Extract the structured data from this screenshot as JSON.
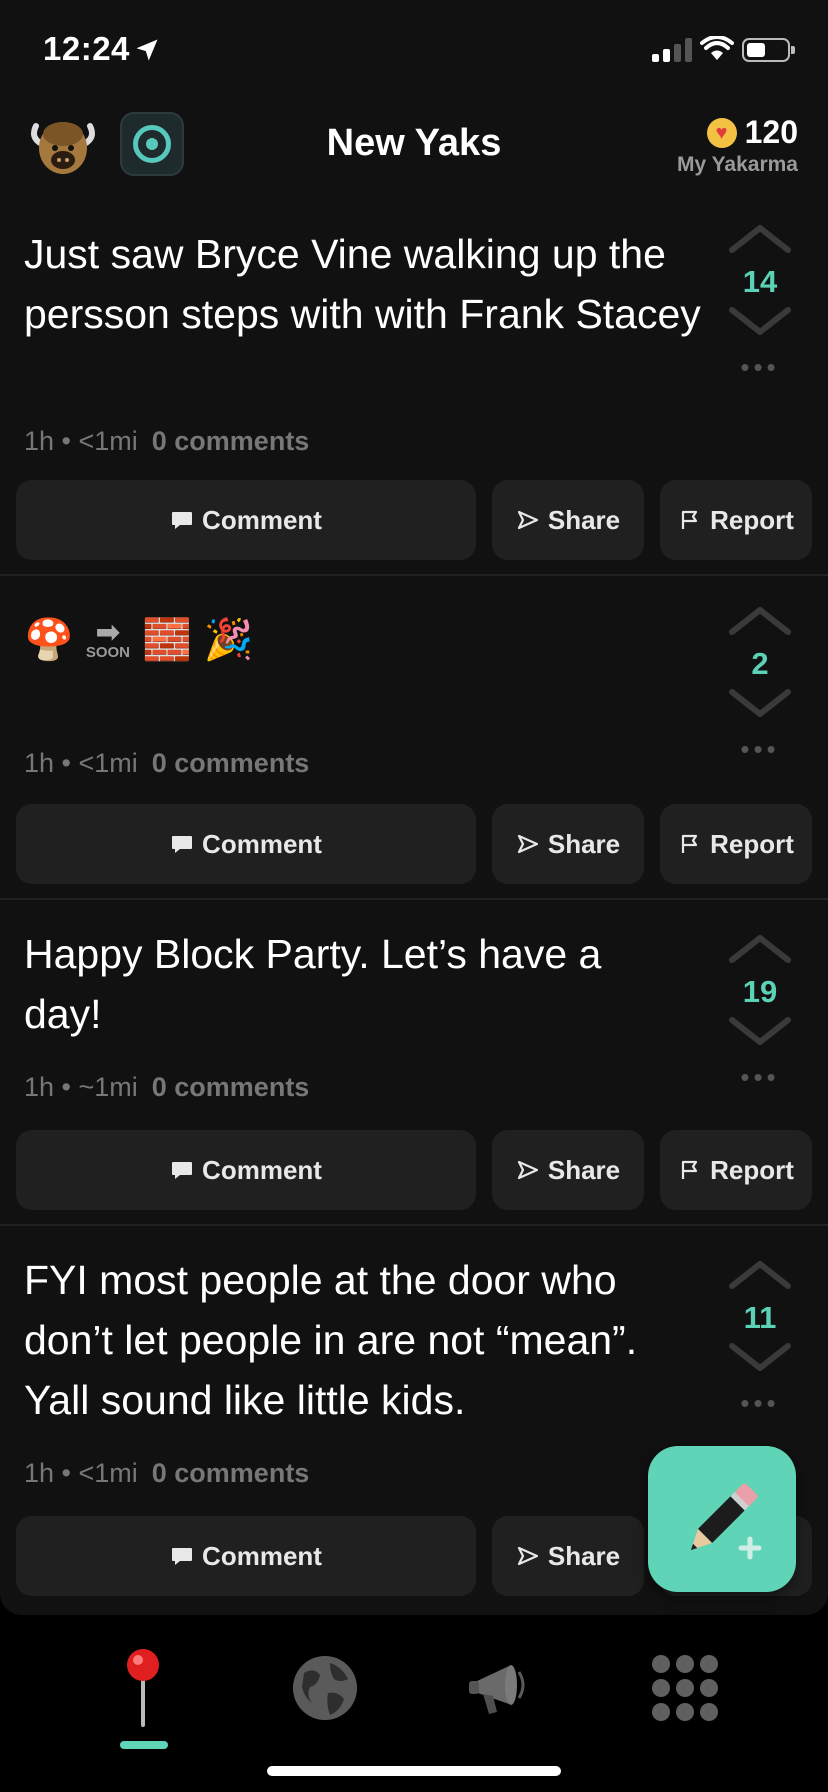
{
  "status_bar": {
    "time": "12:24"
  },
  "header": {
    "title": "New Yaks",
    "karma_value": "120",
    "karma_label": "My Yakarma"
  },
  "posts": [
    {
      "text": "Just saw Bryce Vine walking up the persson steps with with Frank Stacey",
      "meta": "1h • <1mi",
      "comments": "0 comments",
      "votes": "14"
    },
    {
      "emoji": [
        "🍄",
        "SOON",
        "🧱",
        "🎉"
      ],
      "meta": "1h • <1mi",
      "comments": "0 comments",
      "votes": "2"
    },
    {
      "text": "Happy Block Party. Let’s have a day!",
      "meta": "1h • ~1mi",
      "comments": "0 comments",
      "votes": "19"
    },
    {
      "text": "FYI most people at the door who don’t let people in are not “mean”. Yall sound like little kids.",
      "meta": "1h • <1mi",
      "comments": "0 comments",
      "votes": "11"
    }
  ],
  "actions": {
    "comment": "Comment",
    "share": "Share",
    "report": "Report"
  },
  "colors": {
    "accent": "#5fd4b6",
    "vote_count": "#5bd1b6",
    "background": "#111111",
    "button": "#202020"
  },
  "icons": {
    "tabs": [
      "map-pin-icon",
      "globe-icon",
      "megaphone-icon",
      "grid-icon"
    ],
    "fab": "pencil-plus-icon"
  }
}
